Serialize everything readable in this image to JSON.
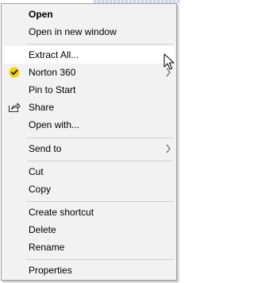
{
  "menu": {
    "items": [
      {
        "label": "Open",
        "bold": true
      },
      {
        "label": "Open in new window"
      },
      {
        "label": "Extract All...",
        "hover": true
      },
      {
        "label": "Norton 360",
        "icon": "norton-check-icon",
        "submenu": true
      },
      {
        "label": "Pin to Start"
      },
      {
        "label": "Share",
        "icon": "share-icon"
      },
      {
        "label": "Open with..."
      },
      {
        "label": "Send to",
        "submenu": true
      },
      {
        "label": "Cut"
      },
      {
        "label": "Copy"
      },
      {
        "label": "Create shortcut"
      },
      {
        "label": "Delete"
      },
      {
        "label": "Rename"
      },
      {
        "label": "Properties"
      }
    ]
  },
  "colors": {
    "menu_bg": "#f2f2f2",
    "hover_bg": "#ffffff",
    "norton_yellow": "#f5d000",
    "separator": "#d0d0d0"
  }
}
